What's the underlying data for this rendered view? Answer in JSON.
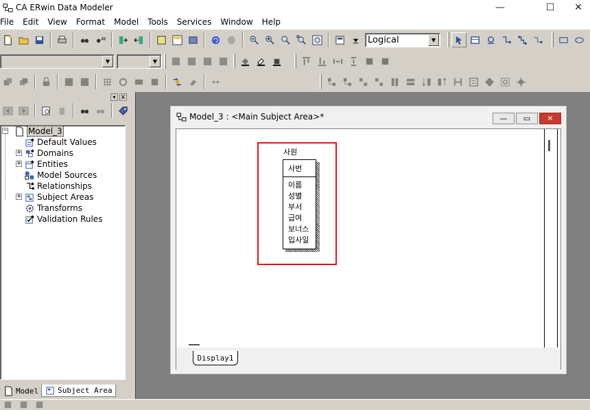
{
  "app": {
    "title": "CA ERwin Data Modeler"
  },
  "window_controls": {
    "minimize": "—",
    "maximize": "☐",
    "close": "✕"
  },
  "menu": [
    "File",
    "Edit",
    "View",
    "Format",
    "Model",
    "Tools",
    "Services",
    "Window",
    "Help"
  ],
  "toolbar": {
    "view_level": "Logical",
    "font_combo": "",
    "size_combo": ""
  },
  "model_explorer": {
    "close_label": "x",
    "root": "Model_3",
    "items": [
      {
        "label": "Default Values",
        "expandable": false,
        "icon": "default-values-icon"
      },
      {
        "label": "Domains",
        "expandable": true,
        "icon": "domains-icon"
      },
      {
        "label": "Entities",
        "expandable": true,
        "icon": "entities-icon"
      },
      {
        "label": "Model Sources",
        "expandable": false,
        "icon": "model-sources-icon"
      },
      {
        "label": "Relationships",
        "expandable": false,
        "icon": "relationships-icon"
      },
      {
        "label": "Subject Areas",
        "expandable": true,
        "icon": "subject-areas-icon"
      },
      {
        "label": "Transforms",
        "expandable": false,
        "icon": "transforms-icon"
      },
      {
        "label": "Validation Rules",
        "expandable": false,
        "icon": "validation-rules-icon"
      }
    ],
    "toggle_symbol": "+",
    "tabs": {
      "model": "Model",
      "subject_area": "Subject Area"
    }
  },
  "diagram_window": {
    "title": "Model_3 : <Main Subject Area>*",
    "display_tab": "Display1",
    "buttons": {
      "minimize": "—",
      "restore": "▭",
      "close": "✕"
    }
  },
  "entity": {
    "name": "사원",
    "primary_key": [
      "사번"
    ],
    "attributes": [
      "이름",
      "성별",
      "부서",
      "급여",
      "보너스",
      "입사일"
    ]
  },
  "colors": {
    "highlight": "#e0141e",
    "toolbar_bg": "#d4d0c8",
    "mdi_bg": "#808080",
    "close_red": "#c7392e"
  }
}
